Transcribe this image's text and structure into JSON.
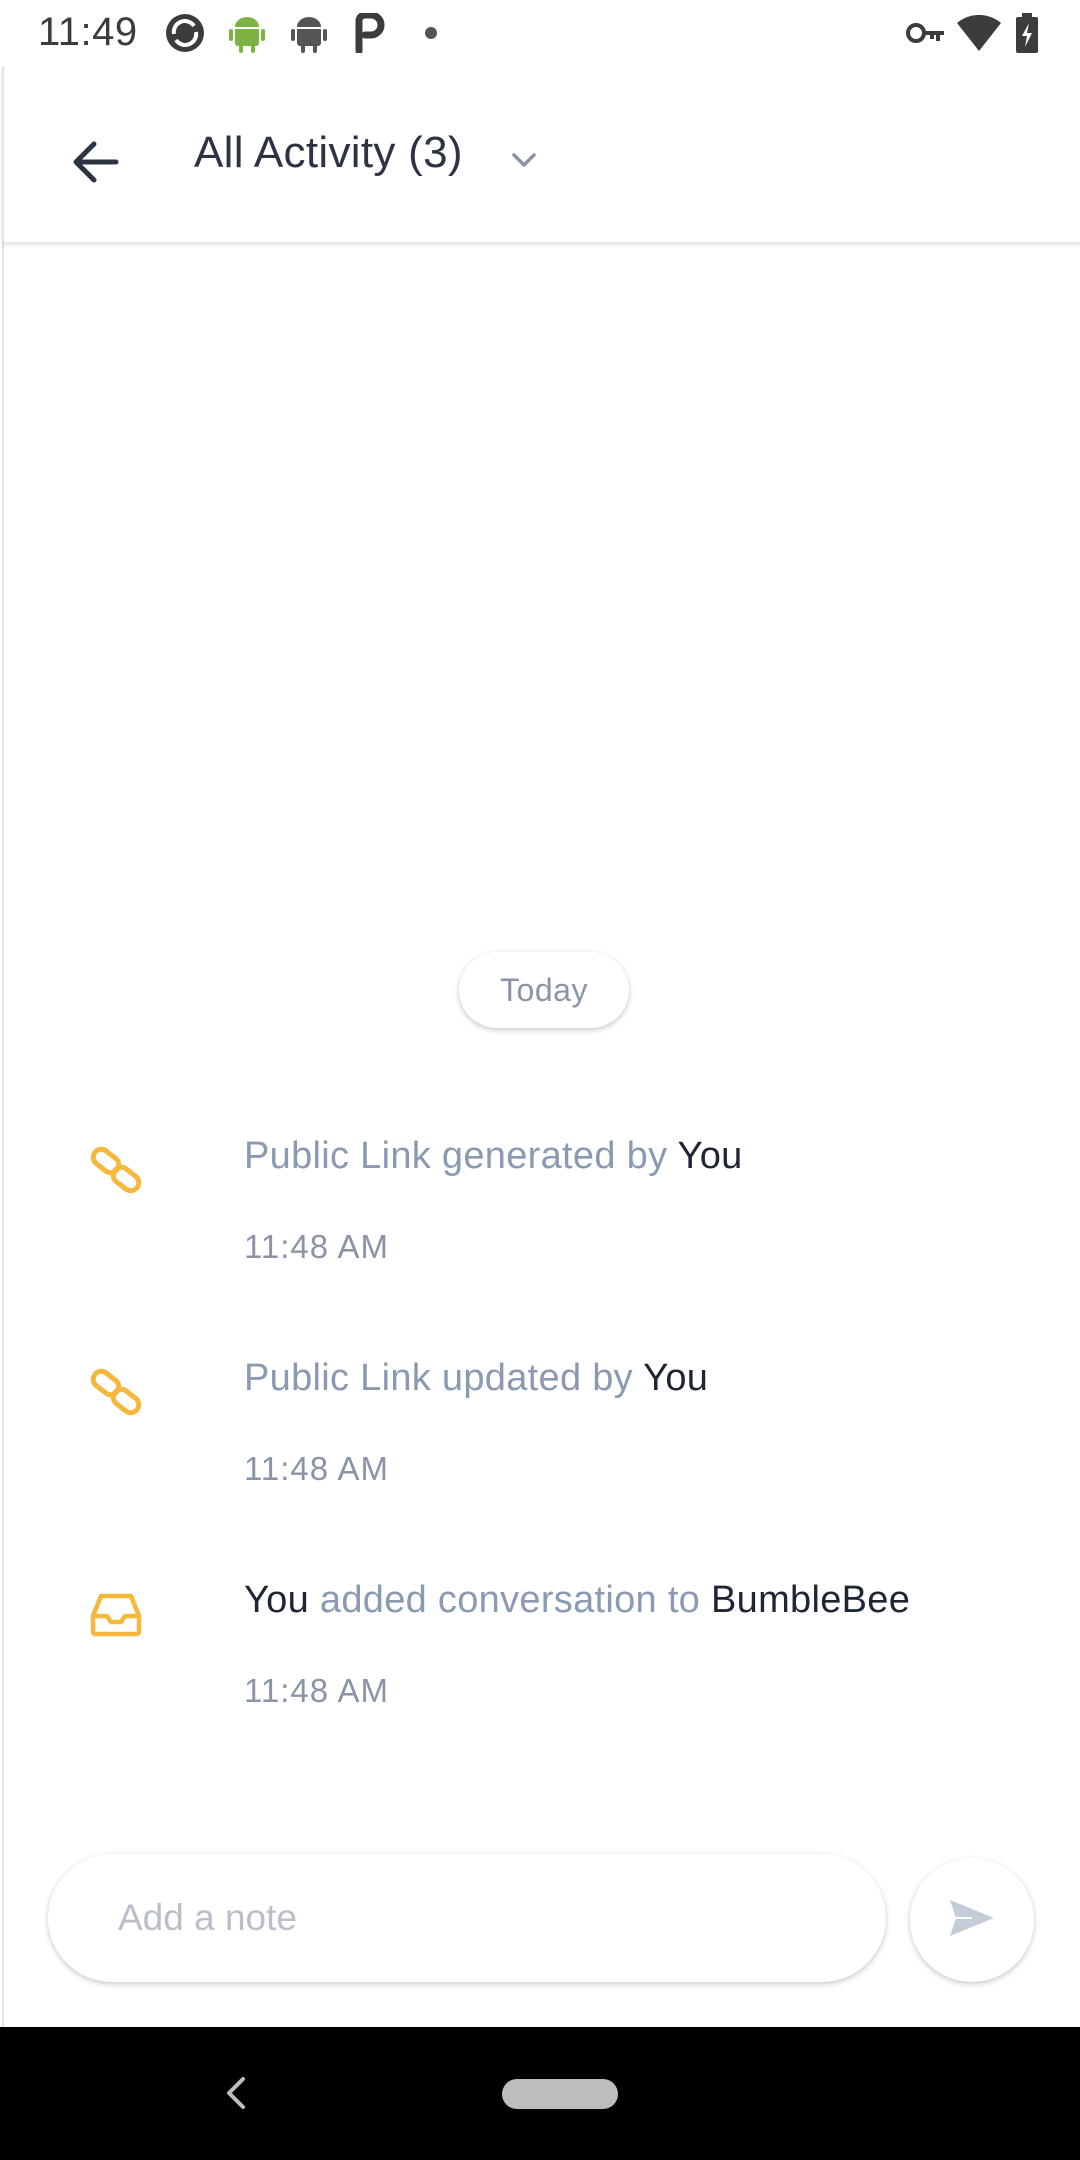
{
  "status_bar": {
    "time": "11:49",
    "left_icons": [
      "sync-icon",
      "android-icon",
      "android-icon",
      "p-icon",
      "dot-icon"
    ],
    "right_icons": [
      "vpn-key-icon",
      "wifi-icon",
      "battery-charging-icon"
    ]
  },
  "header": {
    "title": "All Activity (3)",
    "back_icon": "arrow-left-icon",
    "dropdown_icon": "chevron-down-icon"
  },
  "timeline": {
    "day_label": "Today",
    "items": [
      {
        "icon": "link-icon",
        "parts": [
          {
            "text": "Public Link generated by ",
            "style": "muted"
          },
          {
            "text": "You",
            "style": "strong"
          }
        ],
        "time": "11:48 AM"
      },
      {
        "icon": "link-icon",
        "parts": [
          {
            "text": "Public Link updated by ",
            "style": "muted"
          },
          {
            "text": "You",
            "style": "strong"
          }
        ],
        "time": "11:48 AM"
      },
      {
        "icon": "inbox-icon",
        "parts": [
          {
            "text": "You",
            "style": "strong"
          },
          {
            "text": " added conversation to ",
            "style": "muted"
          },
          {
            "text": "BumbleBee",
            "style": "strong"
          }
        ],
        "time": "11:48 AM"
      }
    ]
  },
  "composer": {
    "placeholder": "Add a note",
    "value": "",
    "send_icon": "send-icon"
  },
  "colors": {
    "accent_icon": "#f5b83d",
    "title_text": "#2c3444",
    "muted_text": "#8a9ab2",
    "strong_text": "#1f2633"
  }
}
